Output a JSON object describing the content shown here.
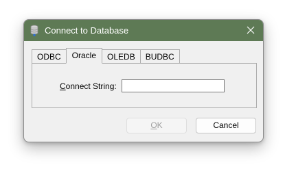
{
  "window": {
    "title": "Connect to Database",
    "icon": "database-icon",
    "close_icon": "close-icon",
    "title_bar_color": "#5e7a55"
  },
  "tabs": [
    {
      "label": "ODBC",
      "active": false
    },
    {
      "label": "Oracle",
      "active": true
    },
    {
      "label": "OLEDB",
      "active": false
    },
    {
      "label": "BUDBC",
      "active": false
    }
  ],
  "form": {
    "connect_string_label_mnemonic": "C",
    "connect_string_label_rest": "onnect String:",
    "connect_string_value": ""
  },
  "buttons": {
    "ok_mnemonic": "O",
    "ok_rest": "K",
    "ok_enabled": false,
    "cancel_label": "Cancel"
  }
}
